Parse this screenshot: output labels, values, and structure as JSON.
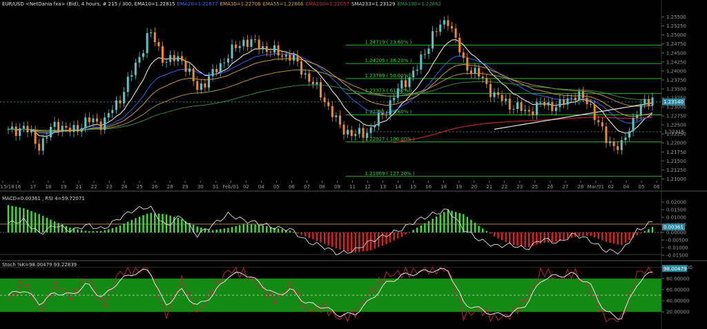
{
  "header": {
    "title": "EUR/USD <NetDania fxa> (Bid), 4 hours, # 215 / 300, EMA10=1.22815",
    "indicators": [
      {
        "text": "EMA20=1.22677",
        "color": "#3a6cff"
      },
      {
        "text": "EMA30=1.22706",
        "color": "#e8a33c"
      },
      {
        "text": "EMA55=1.22866",
        "color": "#c7a03a"
      },
      {
        "text": "EMA200=1.22057",
        "color": "#d03030"
      },
      {
        "text": "SMA233=1.23129",
        "color": "#dddddd"
      },
      {
        "text": "EMA100=1.22862",
        "color": "#2a9a4a"
      }
    ]
  },
  "colors": {
    "up_candle": "#56c7c7",
    "down_candle": "#f08a24",
    "fib_line": "#2fb52f",
    "fib_label": "#34d834",
    "macd_pos": "#3fe03f",
    "macd_neg": "#e02020",
    "stoch_zone": "#138a13"
  },
  "chart_data": [
    {
      "type": "candlestick",
      "title": "EUR/USD <NetDania fxa> (Bid), 4 hours",
      "y_range": [
        1.2095,
        1.2578
      ],
      "y_ticks": [
        "1.25500",
        "1.25250",
        "1.25000",
        "1.24750",
        "1.24500",
        "1.24250",
        "1.24000",
        "1.23750",
        "1.23500",
        "1.23250",
        "1.23000",
        "1.22750",
        "1.22500",
        "1.22250",
        "1.22000",
        "1.21750",
        "1.21500",
        "1.21250",
        "1.21000"
      ],
      "x_labels": [
        "Jan/15/18",
        "16",
        "17",
        "18",
        "19",
        "21",
        "22",
        "23",
        "24",
        "25",
        "26",
        "28",
        "29",
        "30",
        "31",
        "Feb/01",
        "02",
        "04",
        "05",
        "06",
        "07",
        "08",
        "09",
        "11",
        "12",
        "13",
        "14",
        "15",
        "16",
        "18",
        "19",
        "20",
        "21",
        "22",
        "23",
        "25",
        "26",
        "27",
        "28",
        "Mar/01",
        "02",
        "04",
        "05",
        "06"
      ],
      "current_price": {
        "value": 1.2314,
        "label": "1.23140"
      },
      "marker": {
        "value": 1.2231,
        "label": "1.22315"
      },
      "fib_levels": [
        {
          "label": "1.24719 ( 23.60% )",
          "value": 1.24719
        },
        {
          "label": "1.24205 ( 38.20% )",
          "value": 1.24205
        },
        {
          "label": "1.23789 ( 50.00% )",
          "value": 1.23789
        },
        {
          "label": "1.23373 ( 61.80% )",
          "value": 1.23373
        },
        {
          "label": "1.22781 ( 78.60% )",
          "value": 1.22781
        },
        {
          "label": "1.22027 ( 100.00% )",
          "value": 1.22027
        },
        {
          "label": "1.21069 ( 127.20% )",
          "value": 1.21069
        }
      ],
      "close_path": [
        {
          "d": "Jan/15",
          "v": 1.223
        },
        {
          "d": "Jan/16",
          "v": 1.2245
        },
        {
          "d": "Jan/17",
          "v": 1.219
        },
        {
          "d": "Jan/18",
          "v": 1.2255
        },
        {
          "d": "Jan/19",
          "v": 1.223
        },
        {
          "d": "Jan/21",
          "v": 1.2262
        },
        {
          "d": "Jan/22",
          "v": 1.2255
        },
        {
          "d": "Jan/23",
          "v": 1.2315
        },
        {
          "d": "Jan/24",
          "v": 1.2405
        },
        {
          "d": "Jan/25",
          "v": 1.251
        },
        {
          "d": "Jan/26",
          "v": 1.2425
        },
        {
          "d": "Jan/28",
          "v": 1.2438
        },
        {
          "d": "Jan/29",
          "v": 1.235
        },
        {
          "d": "Jan/30",
          "v": 1.239
        },
        {
          "d": "Jan/31",
          "v": 1.2445
        },
        {
          "d": "Feb/01",
          "v": 1.2485
        },
        {
          "d": "Feb/02",
          "v": 1.247
        },
        {
          "d": "Feb/04",
          "v": 1.245
        },
        {
          "d": "Feb/05",
          "v": 1.244
        },
        {
          "d": "Feb/06",
          "v": 1.2385
        },
        {
          "d": "Feb/07",
          "v": 1.233
        },
        {
          "d": "Feb/08",
          "v": 1.225
        },
        {
          "d": "Feb/09",
          "v": 1.222
        },
        {
          "d": "Feb/11",
          "v": 1.2235
        },
        {
          "d": "Feb/12",
          "v": 1.229
        },
        {
          "d": "Feb/13",
          "v": 1.236
        },
        {
          "d": "Feb/14",
          "v": 1.2405
        },
        {
          "d": "Feb/15",
          "v": 1.25
        },
        {
          "d": "Feb/16",
          "v": 1.2545
        },
        {
          "d": "Feb/18",
          "v": 1.242
        },
        {
          "d": "Feb/19",
          "v": 1.2385
        },
        {
          "d": "Feb/20",
          "v": 1.233
        },
        {
          "d": "Feb/21",
          "v": 1.2305
        },
        {
          "d": "Feb/22",
          "v": 1.2285
        },
        {
          "d": "Feb/23",
          "v": 1.231
        },
        {
          "d": "Feb/25",
          "v": 1.23
        },
        {
          "d": "Feb/26",
          "v": 1.2335
        },
        {
          "d": "Feb/27",
          "v": 1.231
        },
        {
          "d": "Feb/28",
          "v": 1.221
        },
        {
          "d": "Mar/01",
          "v": 1.2185
        },
        {
          "d": "Mar/02",
          "v": 1.229
        },
        {
          "d": "Mar/04",
          "v": 1.2325
        }
      ]
    },
    {
      "type": "bar",
      "title": "MACD histogram / RSI",
      "header": "MACD=0.00361 , RSI 4=59.72071",
      "y_range": [
        -0.0168,
        0.0232
      ],
      "y_ticks": [
        "0.02000",
        "0.01500",
        "0.01000",
        "0.00500",
        "0.00000",
        "-0.00500",
        "-0.01000",
        "-0.01500"
      ],
      "current": {
        "value": 0.00361,
        "label": "0.00361"
      },
      "histogram_path": [
        {
          "d": "Jan/15",
          "v": 0.018
        },
        {
          "d": "Jan/16",
          "v": 0.016
        },
        {
          "d": "Jan/17",
          "v": 0.012
        },
        {
          "d": "Jan/18",
          "v": 0.007
        },
        {
          "d": "Jan/19",
          "v": 0.003
        },
        {
          "d": "Jan/21",
          "v": 0.0008
        },
        {
          "d": "Jan/22",
          "v": 0.001
        },
        {
          "d": "Jan/23",
          "v": 0.004
        },
        {
          "d": "Jan/24",
          "v": 0.009
        },
        {
          "d": "Jan/25",
          "v": 0.013
        },
        {
          "d": "Jan/26",
          "v": 0.012
        },
        {
          "d": "Jan/28",
          "v": 0.009
        },
        {
          "d": "Jan/29",
          "v": 0.004
        },
        {
          "d": "Jan/30",
          "v": 0.0015
        },
        {
          "d": "Jan/31",
          "v": 0.003
        },
        {
          "d": "Feb/01",
          "v": 0.0055
        },
        {
          "d": "Feb/02",
          "v": 0.005
        },
        {
          "d": "Feb/04",
          "v": 0.003
        },
        {
          "d": "Feb/05",
          "v": 0.001
        },
        {
          "d": "Feb/06",
          "v": -0.003
        },
        {
          "d": "Feb/07",
          "v": -0.007
        },
        {
          "d": "Feb/08",
          "v": -0.011
        },
        {
          "d": "Feb/09",
          "v": -0.0135
        },
        {
          "d": "Feb/11",
          "v": -0.012
        },
        {
          "d": "Feb/12",
          "v": -0.008
        },
        {
          "d": "Feb/13",
          "v": -0.003
        },
        {
          "d": "Feb/14",
          "v": 0.003
        },
        {
          "d": "Feb/15",
          "v": 0.009
        },
        {
          "d": "Feb/16",
          "v": 0.015
        },
        {
          "d": "Feb/18",
          "v": 0.012
        },
        {
          "d": "Feb/19",
          "v": 0.004
        },
        {
          "d": "Feb/20",
          "v": -0.003
        },
        {
          "d": "Feb/21",
          "v": -0.008
        },
        {
          "d": "Feb/22",
          "v": -0.01
        },
        {
          "d": "Feb/23",
          "v": -0.007
        },
        {
          "d": "Feb/25",
          "v": -0.006
        },
        {
          "d": "Feb/26",
          "v": -0.003
        },
        {
          "d": "Feb/27",
          "v": -0.002
        },
        {
          "d": "Feb/28",
          "v": -0.006
        },
        {
          "d": "Mar/01",
          "v": -0.0085
        },
        {
          "d": "Mar/02",
          "v": -0.002
        },
        {
          "d": "Mar/04",
          "v": 0.0036
        }
      ],
      "rsi_path": [
        {
          "d": "Jan/15",
          "v": 0.006
        },
        {
          "d": "Jan/16",
          "v": 0.008
        },
        {
          "d": "Jan/17",
          "v": -0.001
        },
        {
          "d": "Jan/18",
          "v": 0.005
        },
        {
          "d": "Jan/19",
          "v": 0.001
        },
        {
          "d": "Jan/21",
          "v": 0.005
        },
        {
          "d": "Jan/22",
          "v": 0.002
        },
        {
          "d": "Jan/23",
          "v": 0.009
        },
        {
          "d": "Jan/24",
          "v": 0.015
        },
        {
          "d": "Jan/25",
          "v": 0.017
        },
        {
          "d": "Jan/26",
          "v": 0.004
        },
        {
          "d": "Jan/28",
          "v": 0.011
        },
        {
          "d": "Jan/29",
          "v": -0.002
        },
        {
          "d": "Jan/30",
          "v": 0.005
        },
        {
          "d": "Jan/31",
          "v": 0.012
        },
        {
          "d": "Feb/01",
          "v": 0.008
        },
        {
          "d": "Feb/02",
          "v": 0.006
        },
        {
          "d": "Feb/04",
          "v": 0.003
        },
        {
          "d": "Feb/05",
          "v": 0.002
        },
        {
          "d": "Feb/06",
          "v": -0.006
        },
        {
          "d": "Feb/07",
          "v": -0.009
        },
        {
          "d": "Feb/08",
          "v": -0.014
        },
        {
          "d": "Feb/09",
          "v": -0.012
        },
        {
          "d": "Feb/11",
          "v": -0.006
        },
        {
          "d": "Feb/12",
          "v": -0.002
        },
        {
          "d": "Feb/13",
          "v": 0.002
        },
        {
          "d": "Feb/14",
          "v": 0.008
        },
        {
          "d": "Feb/15",
          "v": 0.012
        },
        {
          "d": "Feb/16",
          "v": 0.015
        },
        {
          "d": "Feb/18",
          "v": 0.002
        },
        {
          "d": "Feb/19",
          "v": -0.005
        },
        {
          "d": "Feb/20",
          "v": -0.009
        },
        {
          "d": "Feb/21",
          "v": -0.008
        },
        {
          "d": "Feb/22",
          "v": -0.011
        },
        {
          "d": "Feb/23",
          "v": -0.004
        },
        {
          "d": "Feb/25",
          "v": -0.007
        },
        {
          "d": "Feb/26",
          "v": -0.001
        },
        {
          "d": "Feb/27",
          "v": -0.005
        },
        {
          "d": "Feb/28",
          "v": -0.012
        },
        {
          "d": "Mar/01",
          "v": -0.013
        },
        {
          "d": "Mar/02",
          "v": 0.001
        },
        {
          "d": "Mar/04",
          "v": 0.007
        }
      ]
    },
    {
      "type": "line",
      "title": "Stochastic",
      "header": "Stoch %K=98.00479 93.22839",
      "y_range": [
        -2,
        107
      ],
      "y_ticks": [
        "100.00000",
        "80.00000",
        "60.00000",
        "40.00000",
        "20.00000"
      ],
      "zone": [
        20,
        80
      ],
      "midline": 50,
      "current": {
        "value": 98.00479,
        "label": "98.00479"
      },
      "k_path": [
        {
          "d": "Jan/15",
          "v": 40
        },
        {
          "d": "Jan/16",
          "v": 75
        },
        {
          "d": "Jan/17",
          "v": 20
        },
        {
          "d": "Jan/18",
          "v": 70
        },
        {
          "d": "Jan/19",
          "v": 45
        },
        {
          "d": "Jan/21",
          "v": 85
        },
        {
          "d": "Jan/22",
          "v": 30
        },
        {
          "d": "Jan/23",
          "v": 90
        },
        {
          "d": "Jan/24",
          "v": 95
        },
        {
          "d": "Jan/25",
          "v": 98
        },
        {
          "d": "Jan/26",
          "v": 10
        },
        {
          "d": "Jan/28",
          "v": 80
        },
        {
          "d": "Jan/29",
          "v": 15
        },
        {
          "d": "Jan/30",
          "v": 60
        },
        {
          "d": "Jan/31",
          "v": 95
        },
        {
          "d": "Feb/01",
          "v": 90
        },
        {
          "d": "Feb/02",
          "v": 65
        },
        {
          "d": "Feb/04",
          "v": 40
        },
        {
          "d": "Feb/05",
          "v": 70
        },
        {
          "d": "Feb/06",
          "v": 20
        },
        {
          "d": "Feb/07",
          "v": 30
        },
        {
          "d": "Feb/08",
          "v": 8
        },
        {
          "d": "Feb/09",
          "v": 15
        },
        {
          "d": "Feb/11",
          "v": 55
        },
        {
          "d": "Feb/12",
          "v": 85
        },
        {
          "d": "Feb/13",
          "v": 90
        },
        {
          "d": "Feb/14",
          "v": 92
        },
        {
          "d": "Feb/15",
          "v": 98
        },
        {
          "d": "Feb/16",
          "v": 96
        },
        {
          "d": "Feb/18",
          "v": 12
        },
        {
          "d": "Feb/19",
          "v": 25
        },
        {
          "d": "Feb/20",
          "v": 8
        },
        {
          "d": "Feb/21",
          "v": 15
        },
        {
          "d": "Feb/22",
          "v": 45
        },
        {
          "d": "Feb/23",
          "v": 95
        },
        {
          "d": "Feb/25",
          "v": 80
        },
        {
          "d": "Feb/26",
          "v": 92
        },
        {
          "d": "Feb/27",
          "v": 60
        },
        {
          "d": "Feb/28",
          "v": 6
        },
        {
          "d": "Mar/01",
          "v": 5
        },
        {
          "d": "Mar/02",
          "v": 90
        },
        {
          "d": "Mar/04",
          "v": 98
        }
      ],
      "d_path": [
        {
          "d": "Jan/15",
          "v": 50
        },
        {
          "d": "Jan/16",
          "v": 60
        },
        {
          "d": "Jan/17",
          "v": 35
        },
        {
          "d": "Jan/18",
          "v": 55
        },
        {
          "d": "Jan/19",
          "v": 50
        },
        {
          "d": "Jan/21",
          "v": 70
        },
        {
          "d": "Jan/22",
          "v": 45
        },
        {
          "d": "Jan/23",
          "v": 75
        },
        {
          "d": "Jan/24",
          "v": 90
        },
        {
          "d": "Jan/25",
          "v": 95
        },
        {
          "d": "Jan/26",
          "v": 30
        },
        {
          "d": "Jan/28",
          "v": 60
        },
        {
          "d": "Jan/29",
          "v": 30
        },
        {
          "d": "Jan/30",
          "v": 50
        },
        {
          "d": "Jan/31",
          "v": 85
        },
        {
          "d": "Feb/01",
          "v": 90
        },
        {
          "d": "Feb/02",
          "v": 72
        },
        {
          "d": "Feb/04",
          "v": 50
        },
        {
          "d": "Feb/05",
          "v": 60
        },
        {
          "d": "Feb/06",
          "v": 35
        },
        {
          "d": "Feb/07",
          "v": 30
        },
        {
          "d": "Feb/08",
          "v": 15
        },
        {
          "d": "Feb/09",
          "v": 15
        },
        {
          "d": "Feb/11",
          "v": 40
        },
        {
          "d": "Feb/12",
          "v": 70
        },
        {
          "d": "Feb/13",
          "v": 85
        },
        {
          "d": "Feb/14",
          "v": 90
        },
        {
          "d": "Feb/15",
          "v": 95
        },
        {
          "d": "Feb/16",
          "v": 95
        },
        {
          "d": "Feb/18",
          "v": 35
        },
        {
          "d": "Feb/19",
          "v": 25
        },
        {
          "d": "Feb/20",
          "v": 15
        },
        {
          "d": "Feb/21",
          "v": 15
        },
        {
          "d": "Feb/22",
          "v": 35
        },
        {
          "d": "Feb/23",
          "v": 80
        },
        {
          "d": "Feb/25",
          "v": 85
        },
        {
          "d": "Feb/26",
          "v": 88
        },
        {
          "d": "Feb/27",
          "v": 70
        },
        {
          "d": "Feb/28",
          "v": 20
        },
        {
          "d": "Mar/01",
          "v": 8
        },
        {
          "d": "Mar/02",
          "v": 70
        },
        {
          "d": "Mar/04",
          "v": 93
        }
      ]
    }
  ]
}
